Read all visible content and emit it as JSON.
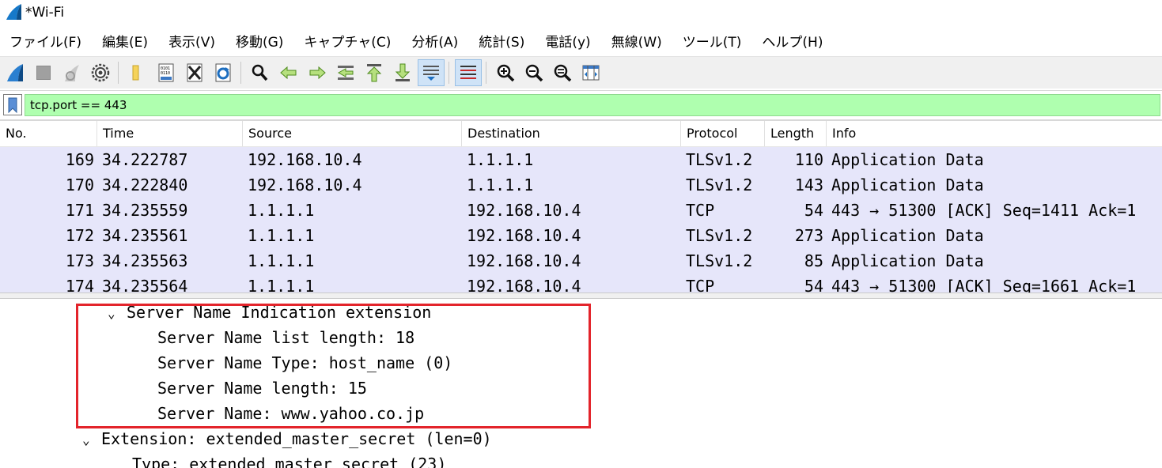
{
  "window": {
    "title": "*Wi-Fi",
    "app_icon": "wireshark-fin-icon"
  },
  "menu": [
    "ファイル(F)",
    "編集(E)",
    "表示(V)",
    "移動(G)",
    "キャプチャ(C)",
    "分析(A)",
    "統計(S)",
    "電話(y)",
    "無線(W)",
    "ツール(T)",
    "ヘルプ(H)"
  ],
  "toolbar": {
    "icons": [
      "start-capture-icon",
      "stop-capture-icon",
      "restart-capture-icon",
      "capture-options-icon",
      "open-file-icon",
      "save-file-icon",
      "close-file-icon",
      "reload-file-icon",
      "find-packet-icon",
      "go-back-icon",
      "go-forward-icon",
      "go-to-packet-icon",
      "first-packet-icon",
      "last-packet-icon",
      "autoscroll-icon",
      "colorize-icon",
      "zoom-in-icon",
      "zoom-out-icon",
      "normal-size-icon",
      "resize-columns-icon"
    ],
    "active": [
      "autoscroll-icon",
      "colorize-icon"
    ]
  },
  "filter": {
    "value": "tcp.port == 443",
    "background": "#afffaf"
  },
  "packet_list": {
    "columns": [
      "No.",
      "Time",
      "Source",
      "Destination",
      "Protocol",
      "Length",
      "Info"
    ],
    "row_color": "#e6e6fa",
    "rows": [
      {
        "no": "169",
        "time": "34.222787",
        "src": "192.168.10.4",
        "dst": "1.1.1.1",
        "proto": "TLSv1.2",
        "len": "110",
        "info": "Application Data"
      },
      {
        "no": "170",
        "time": "34.222840",
        "src": "192.168.10.4",
        "dst": "1.1.1.1",
        "proto": "TLSv1.2",
        "len": "143",
        "info": "Application Data"
      },
      {
        "no": "171",
        "time": "34.235559",
        "src": "1.1.1.1",
        "dst": "192.168.10.4",
        "proto": "TCP",
        "len": "54",
        "info": "443 → 51300 [ACK] Seq=1411 Ack=1"
      },
      {
        "no": "172",
        "time": "34.235561",
        "src": "1.1.1.1",
        "dst": "192.168.10.4",
        "proto": "TLSv1.2",
        "len": "273",
        "info": "Application Data"
      },
      {
        "no": "173",
        "time": "34.235563",
        "src": "1.1.1.1",
        "dst": "192.168.10.4",
        "proto": "TLSv1.2",
        "len": "85",
        "info": "Application Data"
      },
      {
        "no": "174",
        "time": "34.235564",
        "src": "1.1.1.1",
        "dst": "192.168.10.4",
        "proto": "TCP",
        "len": "54",
        "info": "443 → 51300 [ACK] Seq=1661 Ack=1"
      }
    ]
  },
  "details": {
    "sni": {
      "header": "Server Name Indication extension",
      "list_length": "Server Name list length: 18",
      "type": "Server Name Type: host_name (0)",
      "length": "Server Name length: 15",
      "name": "Server Name: www.yahoo.co.jp"
    },
    "ems": {
      "header": "Extension: extended_master_secret (len=0)",
      "type": "Type: extended_master_secret (23)"
    },
    "highlight_color": "#e3242b"
  }
}
